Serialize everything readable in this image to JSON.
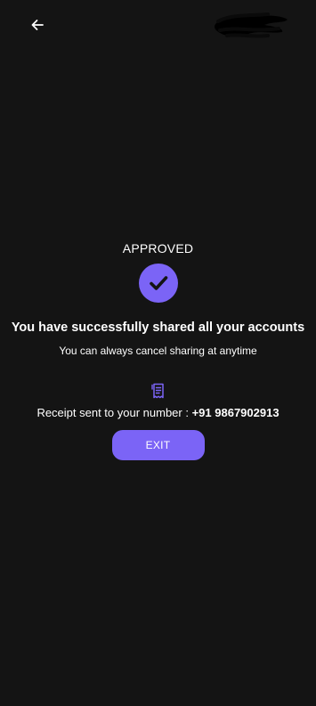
{
  "header": {
    "back_icon": "arrow-left-icon",
    "logo": "redacted-logo"
  },
  "status": {
    "label": "APPROVED",
    "icon": "check-icon"
  },
  "message": {
    "headline": "You have successfully shared all your accounts",
    "subtext": "You can always cancel sharing at anytime"
  },
  "receipt": {
    "icon": "receipt-icon",
    "prefix": "Receipt sent to your number : ",
    "phone": "+91 9867902913"
  },
  "actions": {
    "exit_label": "EXIT"
  },
  "colors": {
    "background": "#141414",
    "accent": "#7b64f6",
    "text": "#ffffff"
  }
}
